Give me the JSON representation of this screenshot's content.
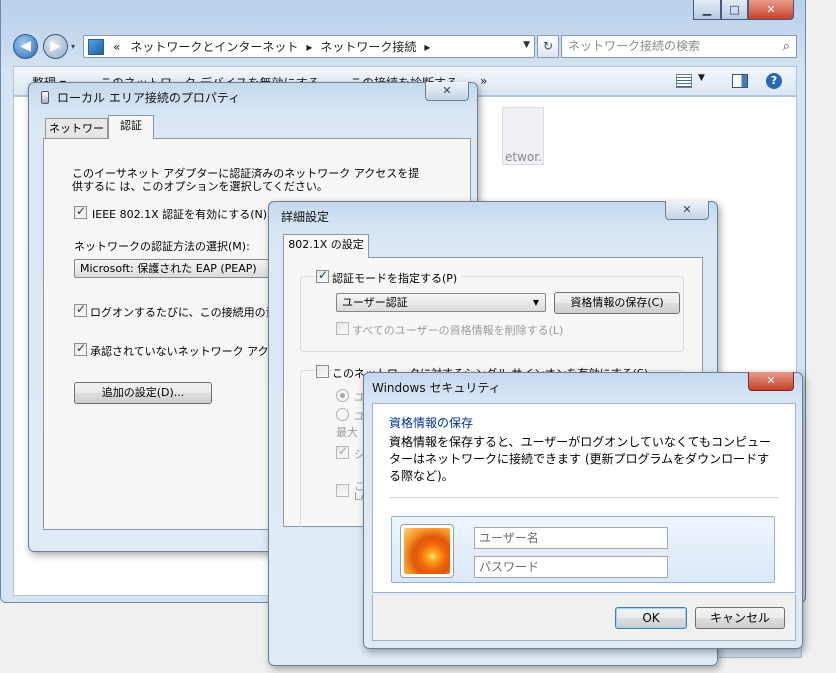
{
  "explorer": {
    "title": "",
    "caption_buttons": {
      "minimize": "▁",
      "maximize": "□",
      "close": "✕"
    },
    "breadcrumb": [
      "«",
      "ネットワークとインターネット",
      "▸",
      "ネットワーク接続",
      "▸"
    ],
    "search_placeholder": "ネットワーク接続の検索",
    "toolbar": {
      "organize": "整理 ▾",
      "disable_device": "このネットワーク デバイスを無効にする",
      "diagnose": "この接続を診断する",
      "more": "»"
    },
    "tile_text": "etwor..."
  },
  "props_dialog": {
    "title": "ローカル エリア接続のプロパティ",
    "close": "✕",
    "tabs": [
      "ネットワーク",
      "認証"
    ],
    "description": "このイーサネット アダプターに認証済みのネットワーク アクセスを提供するに は、このオプションを選択してください。",
    "enable_8021x": "IEEE 802.1X 認証を有効にする(N)",
    "method_label": "ネットワークの認証方法の選択(M):",
    "method_value": "Microsoft: 保護された EAP (PEAP)",
    "remember_creds": "ログオンするたびに、この接続用の資格",
    "fallback": "承認されていないネットワーク アクセスに",
    "additional_settings": "追加の設定(D)..."
  },
  "advanced_dialog": {
    "title": "詳細設定",
    "close": "✕",
    "tab": "802.1X の設定",
    "specify_mode": "認証モードを指定する(P)",
    "mode_value": "ユーザー認証",
    "save_credentials": "資格情報の保存(C)",
    "delete_all": "すべてのユーザーの資格情報を削除する(L)",
    "sso": "このネットワークに対するシングル サインオンを有効にする(S)",
    "radio1": "ユ",
    "radio2": "ユ",
    "max_delay": "最大",
    "checkbox_a": "シ",
    "checkbox_b_1": "この",
    "checkbox_b_2": "LA"
  },
  "security_dialog": {
    "title": "Windows セキュリティ",
    "close": "✕",
    "heading": "資格情報の保存",
    "body": "資格情報を保存すると、ユーザーがログオンしていなくてもコンピューターはネットワークに接続できます (更新プログラムをダウンロードする際など)。",
    "username_placeholder": "ユーザー名",
    "password_placeholder": "パスワード",
    "ok": "OK",
    "cancel": "キャンセル"
  },
  "colors": {
    "heading_blue": "#003399",
    "window_frame": "#c5d8ee",
    "close_red": "#c7412b"
  }
}
